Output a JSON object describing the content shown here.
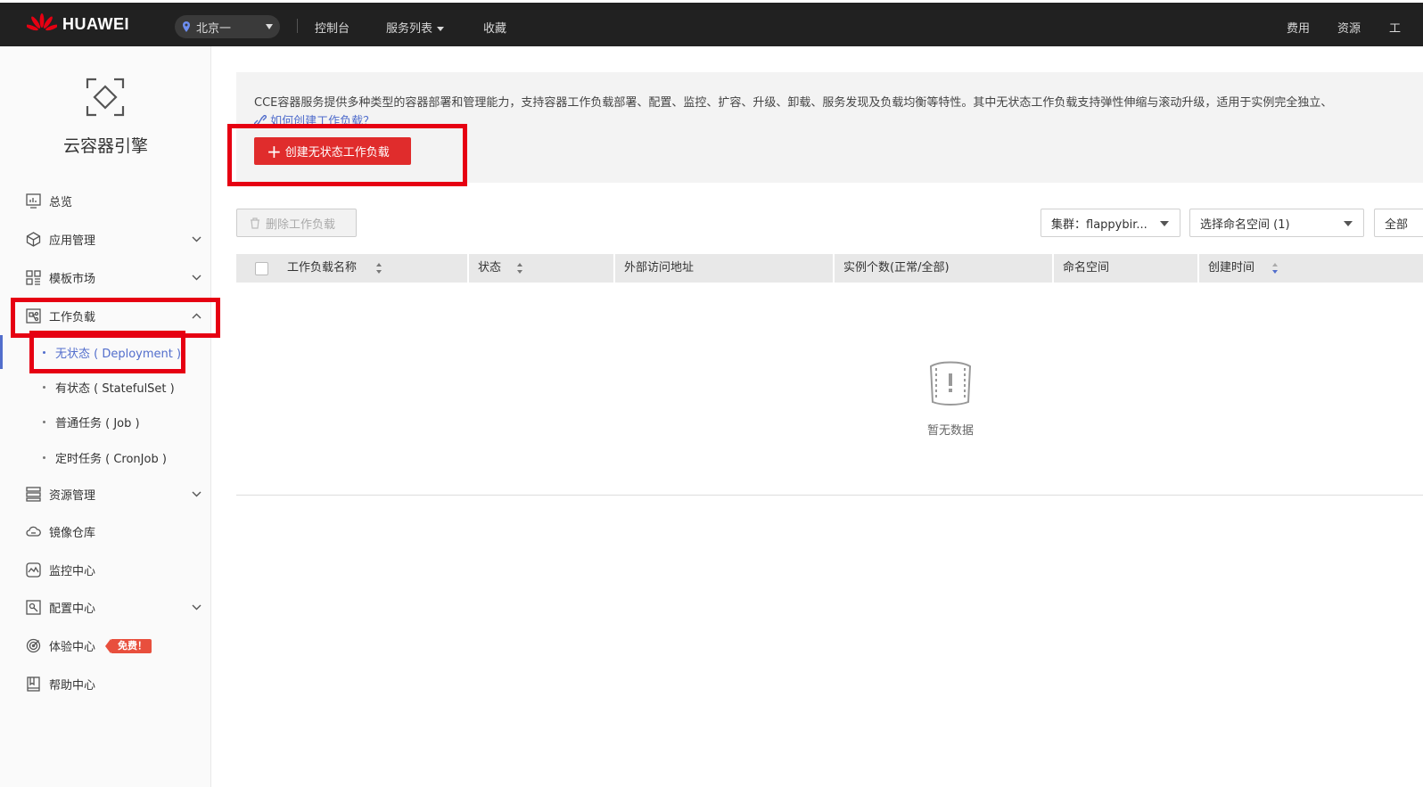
{
  "brand": {
    "name": "HUAWEI",
    "color": "#e60012"
  },
  "topbar": {
    "region": "北京一",
    "console": "控制台",
    "service_list": "服务列表",
    "favorites": "收藏",
    "billing": "费用",
    "resources": "资源",
    "more": "工"
  },
  "sidebar": {
    "product_name": "云容器引擎",
    "items": [
      {
        "label": "总览",
        "icon": "dashboard-icon"
      },
      {
        "label": "应用管理",
        "icon": "cube-icon"
      },
      {
        "label": "模板市场",
        "icon": "grid-icon"
      },
      {
        "label": "工作负载",
        "icon": "workload-icon"
      },
      {
        "label": "资源管理",
        "icon": "server-icon"
      },
      {
        "label": "镜像仓库",
        "icon": "cloud-icon"
      },
      {
        "label": "监控中心",
        "icon": "monitor-icon"
      },
      {
        "label": "配置中心",
        "icon": "config-icon"
      },
      {
        "label": "体验中心",
        "icon": "target-icon"
      },
      {
        "label": "帮助中心",
        "icon": "book-icon"
      }
    ],
    "workload_subitems": [
      {
        "label": "无状态 ( Deployment )"
      },
      {
        "label": "有状态 ( StatefulSet )"
      },
      {
        "label": "普通任务 ( Job )"
      },
      {
        "label": "定时任务 ( CronJob )"
      }
    ],
    "free_badge": "免费！"
  },
  "main": {
    "description": "CCE容器服务提供多种类型的容器部署和管理能力，支持容器工作负载部署、配置、监控、扩容、升级、卸载、服务发现及负载均衡等特性。其中无状态工作负载支持弹性伸缩与滚动升级，适用于实例完全独立、",
    "help_link": "如何创建工作负载？",
    "create_button": "创建无状态工作负载",
    "delete_button": "删除工作负载",
    "cluster_select": "集群：flappybir...",
    "namespace_select": "选择命名空间 (1)",
    "extra_select": "全部",
    "columns": [
      "工作负载名称",
      "状态",
      "外部访问地址",
      "实例个数(正常/全部)",
      "命名空间",
      "创建时间"
    ],
    "empty_text": "暂无数据"
  },
  "colors": {
    "accent": "#526ecc",
    "highlight": "#e60012",
    "primary_button": "#e02c2c"
  }
}
